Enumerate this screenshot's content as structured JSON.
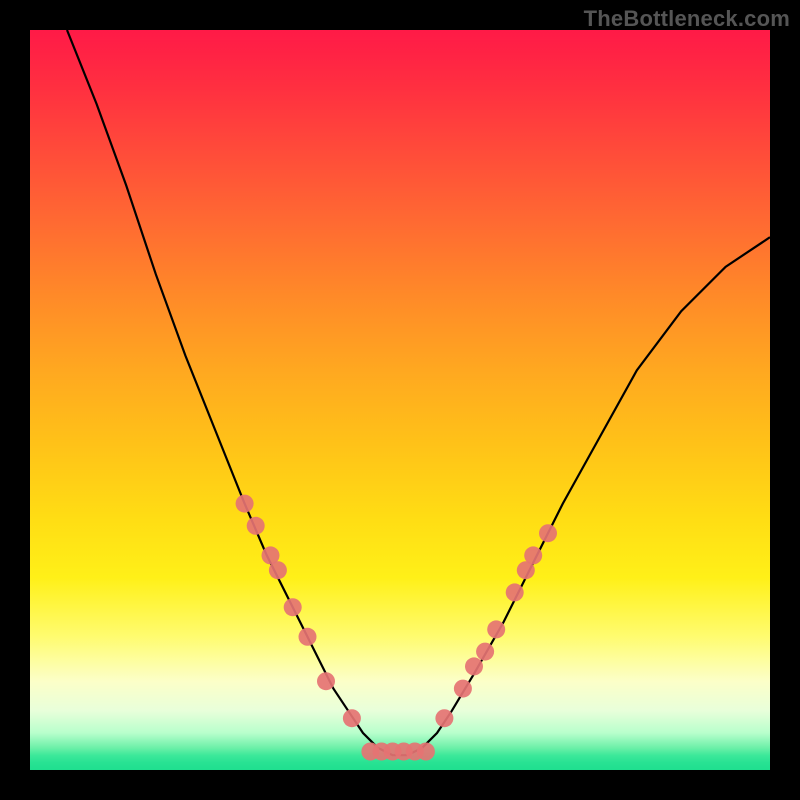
{
  "watermark": "TheBottleneck.com",
  "chart_data": {
    "type": "line",
    "title": "",
    "xlabel": "",
    "ylabel": "",
    "xlim": [
      0,
      100
    ],
    "ylim": [
      0,
      100
    ],
    "grid": false,
    "series": [
      {
        "name": "bottleneck-curve",
        "x": [
          5,
          9,
          13,
          17,
          21,
          25,
          29,
          32,
          35,
          38,
          41,
          43,
          45,
          47,
          49,
          51,
          53,
          55,
          57,
          60,
          64,
          68,
          72,
          77,
          82,
          88,
          94,
          100
        ],
        "y": [
          100,
          90,
          79,
          67,
          56,
          46,
          36,
          29,
          23,
          17,
          11,
          8,
          5,
          3,
          2,
          2,
          3,
          5,
          8,
          13,
          20,
          28,
          36,
          45,
          54,
          62,
          68,
          72
        ],
        "color": "#000000"
      }
    ],
    "markers": [
      {
        "name": "left-cluster",
        "color": "#e57373",
        "points": [
          {
            "x": 29.0,
            "y": 36
          },
          {
            "x": 30.5,
            "y": 33
          },
          {
            "x": 32.5,
            "y": 29
          },
          {
            "x": 33.5,
            "y": 27
          },
          {
            "x": 35.5,
            "y": 22
          },
          {
            "x": 37.5,
            "y": 18
          },
          {
            "x": 40.0,
            "y": 12
          },
          {
            "x": 43.5,
            "y": 7
          }
        ]
      },
      {
        "name": "valley-floor",
        "color": "#e57373",
        "points": [
          {
            "x": 46,
            "y": 2.5
          },
          {
            "x": 47.5,
            "y": 2.5
          },
          {
            "x": 49,
            "y": 2.5
          },
          {
            "x": 50.5,
            "y": 2.5
          },
          {
            "x": 52,
            "y": 2.5
          },
          {
            "x": 53.5,
            "y": 2.5
          }
        ]
      },
      {
        "name": "right-cluster",
        "color": "#e57373",
        "points": [
          {
            "x": 56.0,
            "y": 7
          },
          {
            "x": 58.5,
            "y": 11
          },
          {
            "x": 60.0,
            "y": 14
          },
          {
            "x": 61.5,
            "y": 16
          },
          {
            "x": 63.0,
            "y": 19
          },
          {
            "x": 65.5,
            "y": 24
          },
          {
            "x": 67.0,
            "y": 27
          },
          {
            "x": 68.0,
            "y": 29
          },
          {
            "x": 70.0,
            "y": 32
          }
        ]
      }
    ]
  }
}
